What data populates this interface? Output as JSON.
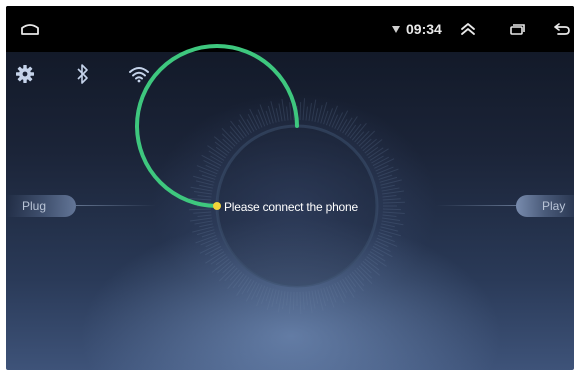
{
  "status_bar": {
    "time": "09:34",
    "icons": [
      "home-icon",
      "signal-icon",
      "double-chevron-up-icon",
      "recent-apps-icon",
      "back-icon"
    ]
  },
  "toolbar": {
    "icons": [
      "settings-gear-icon",
      "bluetooth-icon",
      "wifi-icon"
    ]
  },
  "main": {
    "status_text": "Please connect the phone",
    "left_button": "Plug",
    "right_button": "Play"
  },
  "colors": {
    "ring": "#3ec77e",
    "dot": "#f2d43a",
    "status_bar": "#000000"
  }
}
